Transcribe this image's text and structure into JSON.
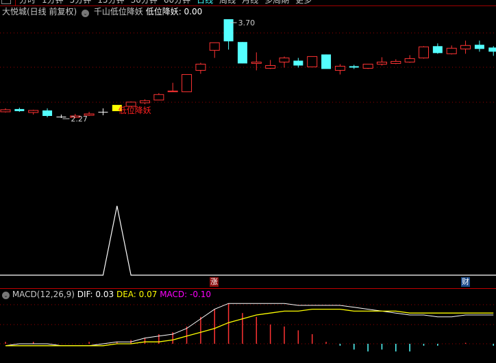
{
  "menu": {
    "items": [
      "分时",
      "1分钟",
      "5分钟",
      "15分钟",
      "30分钟",
      "60分钟",
      "日线",
      "周线",
      "月线",
      "多周期",
      "更多"
    ],
    "active": "日线"
  },
  "header": {
    "stock": "大悦城(日线 前复权)",
    "indicator": "千山低位降妖",
    "value_label": "低位降妖: 0.00"
  },
  "annotations": {
    "high": "3.70",
    "low": "2.27",
    "signal_text": "低位降妖"
  },
  "marks": {
    "zhang": "涨",
    "cai": "财"
  },
  "macd": {
    "title": "MACD(12,26,9)",
    "dif": "DIF: 0.03",
    "dea": "DEA: 0.07",
    "macd": "MACD: -0.10"
  },
  "colors": {
    "up": "#ff3333",
    "down": "#54ffff",
    "dif": "#ffffff",
    "dea": "#ffff00",
    "signal": "#ffffff",
    "highlight": "#ffff00",
    "grid": "#a00000"
  },
  "candles": [
    [
      2.36,
      2.41,
      2.35,
      2.39
    ],
    [
      2.4,
      2.42,
      2.36,
      2.37
    ],
    [
      2.35,
      2.39,
      2.32,
      2.38
    ],
    [
      2.38,
      2.41,
      2.28,
      2.3
    ],
    [
      2.29,
      2.32,
      2.27,
      2.29
    ],
    [
      2.28,
      2.33,
      2.27,
      2.3
    ],
    [
      2.31,
      2.36,
      2.3,
      2.33
    ],
    [
      2.36,
      2.41,
      2.31,
      2.36
    ],
    [
      2.37,
      2.46,
      2.37,
      2.46
    ],
    [
      2.44,
      2.51,
      2.43,
      2.5
    ],
    [
      2.49,
      2.54,
      2.47,
      2.52
    ],
    [
      2.53,
      2.63,
      2.53,
      2.61
    ],
    [
      2.65,
      2.78,
      2.65,
      2.66
    ],
    [
      2.65,
      2.9,
      2.65,
      2.9
    ],
    [
      2.96,
      3.07,
      2.91,
      3.05
    ],
    [
      3.25,
      3.36,
      3.14,
      3.36
    ],
    [
      3.7,
      3.7,
      3.26,
      3.38
    ],
    [
      3.37,
      3.37,
      3.06,
      3.06
    ],
    [
      3.06,
      3.22,
      2.96,
      3.08
    ],
    [
      2.99,
      3.11,
      2.98,
      3.03
    ],
    [
      3.08,
      3.16,
      3.0,
      3.14
    ],
    [
      3.1,
      3.14,
      3.0,
      3.03
    ],
    [
      3.01,
      3.16,
      3.01,
      3.16
    ],
    [
      3.19,
      3.19,
      2.98,
      2.98
    ],
    [
      2.96,
      3.05,
      2.9,
      3.02
    ],
    [
      3.02,
      3.04,
      2.98,
      3.0
    ],
    [
      2.99,
      3.05,
      2.98,
      3.05
    ],
    [
      3.05,
      3.15,
      3.03,
      3.08
    ],
    [
      3.06,
      3.12,
      3.05,
      3.09
    ],
    [
      3.08,
      3.18,
      3.07,
      3.13
    ],
    [
      3.14,
      3.31,
      3.13,
      3.3
    ],
    [
      3.31,
      3.35,
      3.2,
      3.21
    ],
    [
      3.2,
      3.32,
      3.19,
      3.28
    ],
    [
      3.27,
      3.39,
      3.2,
      3.32
    ],
    [
      3.33,
      3.39,
      3.23,
      3.27
    ],
    [
      3.29,
      3.31,
      3.17,
      3.23
    ]
  ],
  "highlight_index": 8,
  "signal": [
    0,
    0,
    0,
    0,
    0,
    0,
    0,
    0,
    1,
    0,
    0,
    0,
    0,
    0,
    0,
    0,
    0,
    0,
    0,
    0,
    0,
    0,
    0,
    0,
    0,
    0,
    0,
    0,
    0,
    0,
    0,
    0,
    0,
    0,
    0,
    0
  ],
  "dif": [
    -0.01,
    0,
    0,
    0,
    -0.01,
    -0.01,
    -0.01,
    0,
    0.01,
    0.01,
    0.03,
    0.04,
    0.05,
    0.08,
    0.13,
    0.18,
    0.21,
    0.21,
    0.21,
    0.21,
    0.21,
    0.2,
    0.2,
    0.2,
    0.2,
    0.19,
    0.18,
    0.17,
    0.16,
    0.15,
    0.15,
    0.14,
    0.14,
    0.15,
    0.15,
    0.15
  ],
  "dea": [
    -0.01,
    -0.01,
    -0.01,
    -0.01,
    -0.01,
    -0.01,
    -0.01,
    -0.01,
    0,
    0,
    0.01,
    0.01,
    0.02,
    0.04,
    0.06,
    0.08,
    0.11,
    0.13,
    0.15,
    0.16,
    0.17,
    0.17,
    0.18,
    0.18,
    0.18,
    0.17,
    0.17,
    0.17,
    0.17,
    0.16,
    0.16,
    0.16,
    0.16,
    0.16,
    0.16,
    0.16
  ],
  "hist": [
    0.01,
    0,
    0.01,
    0,
    0,
    0,
    0.01,
    0,
    0.01,
    0.02,
    0.03,
    0.05,
    0.06,
    0.09,
    0.14,
    0.18,
    0.21,
    0.16,
    0.14,
    0.1,
    0.09,
    0.07,
    0.05,
    0.01,
    -0.01,
    -0.03,
    -0.04,
    -0.03,
    -0.04,
    -0.04,
    -0.01,
    -0.01,
    0,
    0.005,
    0,
    -0.01
  ]
}
